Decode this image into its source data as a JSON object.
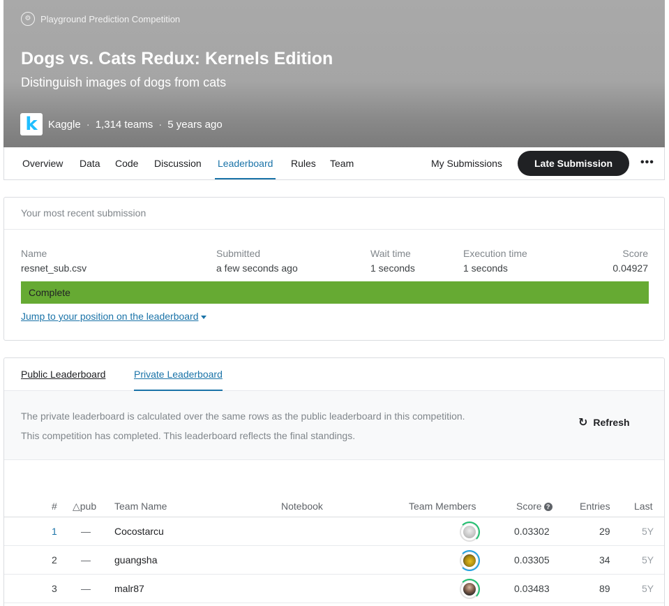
{
  "header": {
    "competition_type": "Playground Prediction Competition",
    "title": "Dogs vs. Cats Redux: Kernels Edition",
    "subtitle": "Distinguish images of dogs from cats",
    "host_logo": "k",
    "host": "Kaggle",
    "teams": "1,314 teams",
    "age": "5 years ago",
    "separator": "·"
  },
  "nav": {
    "tabs": [
      {
        "label": "Overview"
      },
      {
        "label": "Data"
      },
      {
        "label": "Code"
      },
      {
        "label": "Discussion"
      },
      {
        "label": "Leaderboard",
        "active": true
      },
      {
        "label": "Rules"
      },
      {
        "label": "Team"
      }
    ],
    "my_submissions": "My Submissions",
    "late_submission": "Late Submission",
    "more": "•••"
  },
  "recent_submission": {
    "heading": "Your most recent submission",
    "columns": {
      "name_label": "Name",
      "name": "resnet_sub.csv",
      "submitted_label": "Submitted",
      "submitted": "a few seconds ago",
      "wait_label": "Wait time",
      "wait": "1 seconds",
      "exec_label": "Execution time",
      "exec": "1 seconds",
      "score_label": "Score",
      "score": "0.04927"
    },
    "status": "Complete",
    "status_color": "#66aa33",
    "jump_link": "Jump to your position on the leaderboard"
  },
  "leaderboard": {
    "tabs": {
      "public": "Public Leaderboard",
      "private": "Private Leaderboard"
    },
    "notice_line1": "The private leaderboard is calculated over the same rows as the public leaderboard in this competition.",
    "notice_line2": "This competition has completed. This leaderboard reflects the final standings.",
    "refresh": "Refresh",
    "headers": {
      "rank": "#",
      "delta": "△pub",
      "team": "Team Name",
      "notebook": "Notebook",
      "members": "Team Members",
      "score": "Score",
      "entries": "Entries",
      "last": "Last"
    },
    "rows": [
      {
        "rank": "1",
        "delta": "—",
        "team": "Cocostarcu",
        "score": "0.03302",
        "entries": "29",
        "last": "5Y"
      },
      {
        "rank": "2",
        "delta": "—",
        "team": "guangsha",
        "score": "0.03305",
        "entries": "34",
        "last": "5Y"
      },
      {
        "rank": "3",
        "delta": "—",
        "team": "malr87",
        "score": "0.03483",
        "entries": "89",
        "last": "5Y"
      }
    ]
  },
  "colors": {
    "accent": "#1a73a8",
    "complete": "#66aa33",
    "dark_button": "#202124"
  }
}
